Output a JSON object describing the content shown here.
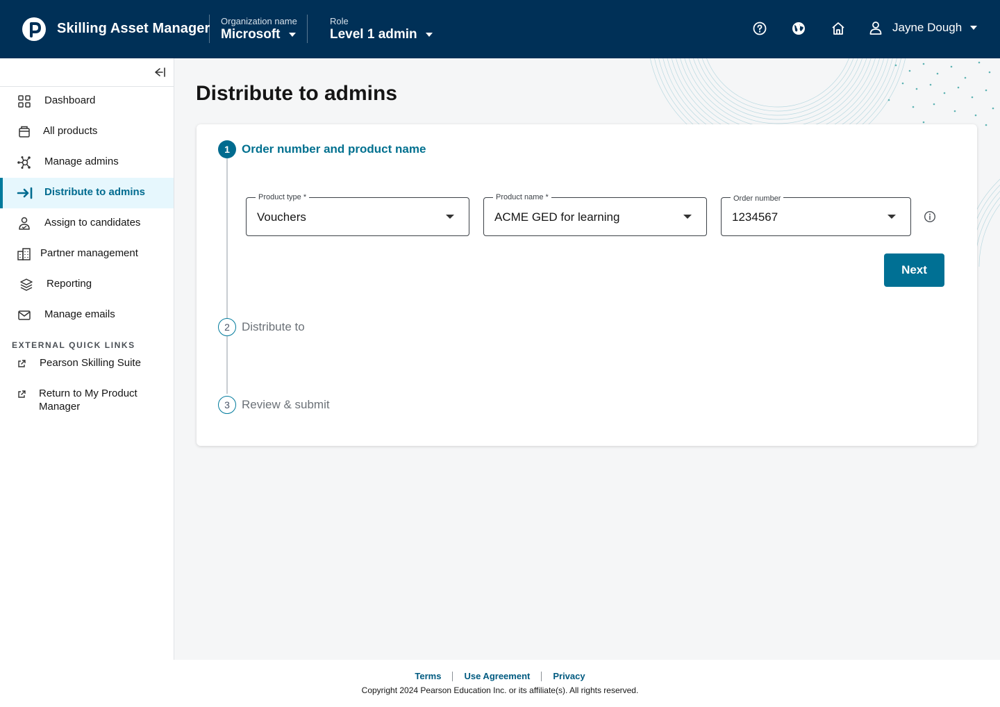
{
  "header": {
    "app_title": "Skilling Asset Manager",
    "org_label": "Organization name",
    "org_value": "Microsoft",
    "role_label": "Role",
    "role_value": "Level 1 admin",
    "user_name": "Jayne Dough",
    "icons": [
      "help-icon",
      "globe-icon",
      "home-icon",
      "user-icon"
    ]
  },
  "sidebar": {
    "items": [
      {
        "label": "Dashboard",
        "icon": "dashboard-icon"
      },
      {
        "label": "All products",
        "icon": "products-icon"
      },
      {
        "label": "Manage admins",
        "icon": "network-icon"
      },
      {
        "label": "Distribute to admins",
        "icon": "distribute-icon",
        "active": true
      },
      {
        "label": "Assign to candidates",
        "icon": "candidate-icon"
      },
      {
        "label": "Partner management",
        "icon": "building-icon"
      },
      {
        "label": "Reporting",
        "icon": "layers-icon"
      },
      {
        "label": "Manage emails",
        "icon": "mail-icon"
      }
    ],
    "quick_links_title": "EXTERNAL QUICK LINKS",
    "quick_links": [
      {
        "label": "Pearson Skilling Suite"
      },
      {
        "label": "Return to My Product Manager"
      }
    ]
  },
  "main": {
    "page_title": "Distribute to admins",
    "steps": [
      {
        "number": "1",
        "label": "Order number and product name",
        "state": "active"
      },
      {
        "number": "2",
        "label": "Distribute to",
        "state": "pending"
      },
      {
        "number": "3",
        "label": "Review & submit",
        "state": "pending"
      }
    ],
    "fields": {
      "product_type": {
        "label": "Product type *",
        "value": "Vouchers"
      },
      "product_name": {
        "label": "Product name *",
        "value": "ACME GED for learning"
      },
      "order_number": {
        "label": "Order number",
        "value": "1234567"
      }
    },
    "next_label": "Next"
  },
  "footer": {
    "links": [
      "Terms",
      "Use Agreement",
      "Privacy"
    ],
    "copyright": "Copyright 2024 Pearson Education Inc. or its affiliate(s). All rights reserved."
  },
  "colors": {
    "header_bg": "#003057",
    "accent": "#007094",
    "active_nav_bg": "#e6f7fd"
  }
}
